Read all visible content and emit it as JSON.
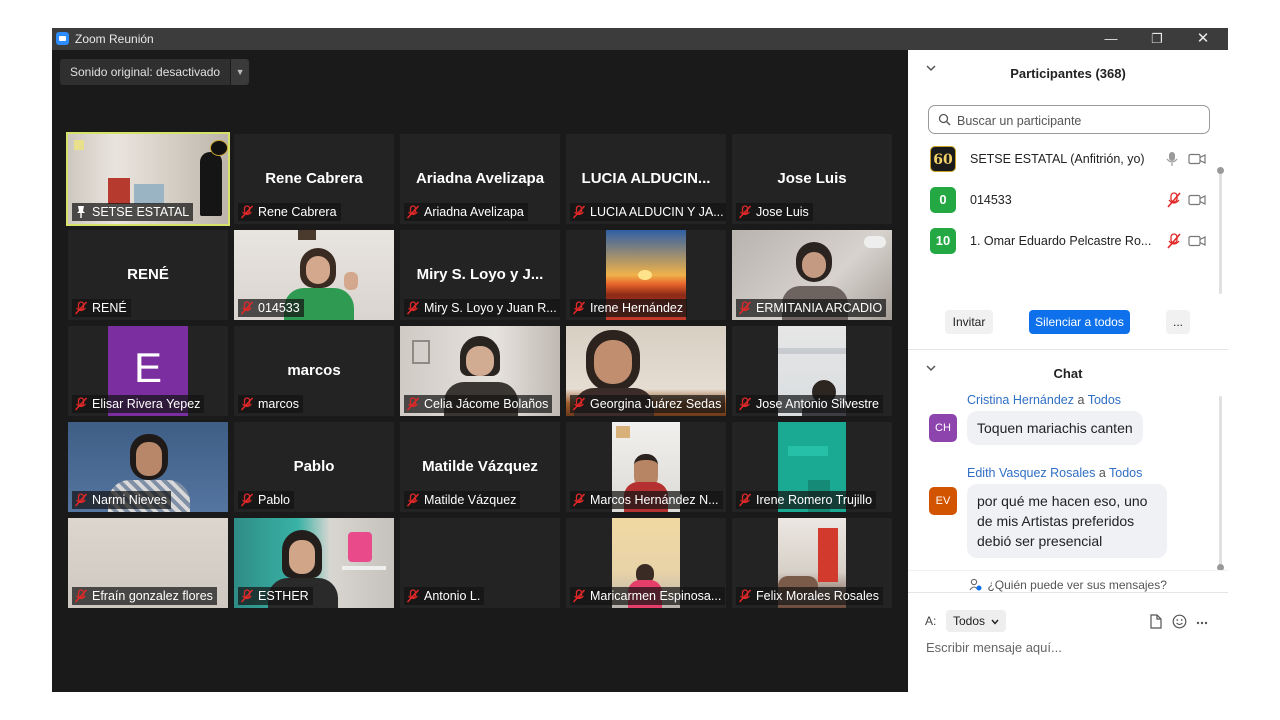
{
  "window": {
    "title": "Zoom Reunión",
    "minimize": "—",
    "restore": "❐",
    "close": "✕"
  },
  "audio": {
    "sound_label": "Sonido original: desactivado",
    "dropdown": "▼"
  },
  "tiles": [
    {
      "row": 0,
      "col": 0,
      "big": "",
      "label": "SETSE ESTATAL",
      "video": "setse",
      "active": true,
      "pin": true
    },
    {
      "row": 0,
      "col": 1,
      "big": "Rene Cabrera",
      "label": "Rene Cabrera"
    },
    {
      "row": 0,
      "col": 2,
      "big": "Ariadna Avelizapa",
      "label": "Ariadna Avelizapa"
    },
    {
      "row": 0,
      "col": 3,
      "big": "LUCIA ALDUCIN...",
      "label": "LUCIA ALDUCIN Y JA..."
    },
    {
      "row": 0,
      "col": 4,
      "big": "Jose Luis",
      "label": "Jose Luis"
    },
    {
      "row": 1,
      "col": 0,
      "big": "RENÉ",
      "label": "RENÉ"
    },
    {
      "row": 1,
      "col": 1,
      "big": "",
      "label": "014533",
      "video": "woman-green"
    },
    {
      "row": 1,
      "col": 2,
      "big": "Miry S. Loyo y J...",
      "label": "Miry S. Loyo y Juan R..."
    },
    {
      "row": 1,
      "col": 3,
      "big": "",
      "label": "Irene Hernández",
      "video": "sunset"
    },
    {
      "row": 1,
      "col": 4,
      "big": "",
      "label": "ERMITANIA ARCADIO",
      "video": "ermitania"
    },
    {
      "row": 2,
      "col": 0,
      "big": "",
      "label": "Elisar Rivera Yepez",
      "video": "letter-e",
      "letter": "E"
    },
    {
      "row": 2,
      "col": 1,
      "big": "marcos",
      "label": "marcos"
    },
    {
      "row": 2,
      "col": 2,
      "big": "",
      "label": "Celia Jácome Bolaños",
      "video": "celia"
    },
    {
      "row": 2,
      "col": 3,
      "big": "",
      "label": "Georgina Juárez Sedas",
      "video": "georgina"
    },
    {
      "row": 2,
      "col": 4,
      "big": "",
      "label": "Jose Antonio Silvestre",
      "video": "jose-antonio"
    },
    {
      "row": 3,
      "col": 0,
      "big": "",
      "label": "Narmi Nieves",
      "video": "narmi"
    },
    {
      "row": 3,
      "col": 1,
      "big": "Pablo",
      "label": "Pablo"
    },
    {
      "row": 3,
      "col": 2,
      "big": "Matilde Vázquez",
      "label": "Matilde Vázquez"
    },
    {
      "row": 3,
      "col": 3,
      "big": "",
      "label": "Marcos Hernández N...",
      "video": "marcos-h"
    },
    {
      "row": 3,
      "col": 4,
      "big": "",
      "label": "Irene Romero Trujillo",
      "video": "irene-romero"
    },
    {
      "row": 4,
      "col": 0,
      "big": "",
      "label": "Efraín gonzalez flores",
      "video": "efrain"
    },
    {
      "row": 4,
      "col": 1,
      "big": "",
      "label": "ESTHER",
      "video": "esther"
    },
    {
      "row": 4,
      "col": 2,
      "big": "",
      "label": "Antonio  L."
    },
    {
      "row": 4,
      "col": 3,
      "big": "",
      "label": "Maricarmen Espinosa...",
      "video": "maricarmen"
    },
    {
      "row": 4,
      "col": 4,
      "big": "",
      "label": "Felix Morales Rosales",
      "video": "felix"
    }
  ],
  "participants": {
    "title": "Participantes (368)",
    "search_placeholder": "Buscar un participante",
    "list": [
      {
        "avatar": "60",
        "avatar_color": "#1b1b1b",
        "name": "SETSE ESTATAL (Anfitrión, yo)",
        "muted": false
      },
      {
        "avatar": "0",
        "avatar_color": "#23a844",
        "name": "014533",
        "muted": true
      },
      {
        "avatar": "10",
        "avatar_color": "#23a844",
        "name": "1. Omar Eduardo Pelcastre Ro...",
        "muted": true
      }
    ],
    "invite": "Invitar",
    "mute_all": "Silenciar a todos",
    "more": "..."
  },
  "chat": {
    "title": "Chat",
    "connector": "a",
    "messages": [
      {
        "initials": "CH",
        "avatar_color": "#8e44ad",
        "from": "Cristina Hernández",
        "to": "Todos",
        "text": "Toquen mariachis canten"
      },
      {
        "initials": "EV",
        "avatar_color": "#d35400",
        "from": "Edith Vasquez Rosales",
        "to": "Todos",
        "text": "por qué me hacen eso, uno de mis Artistas preferidos debió ser presencial"
      }
    ],
    "who_can_see": "¿Quién puede ver sus mensajes?",
    "to_label": "A:",
    "to_value": "Todos",
    "placeholder": "Escribir mensaje aquí..."
  },
  "colors": {
    "accent": "#0e71eb",
    "muted_red": "#e02828",
    "active_border": "#d6e26a"
  }
}
